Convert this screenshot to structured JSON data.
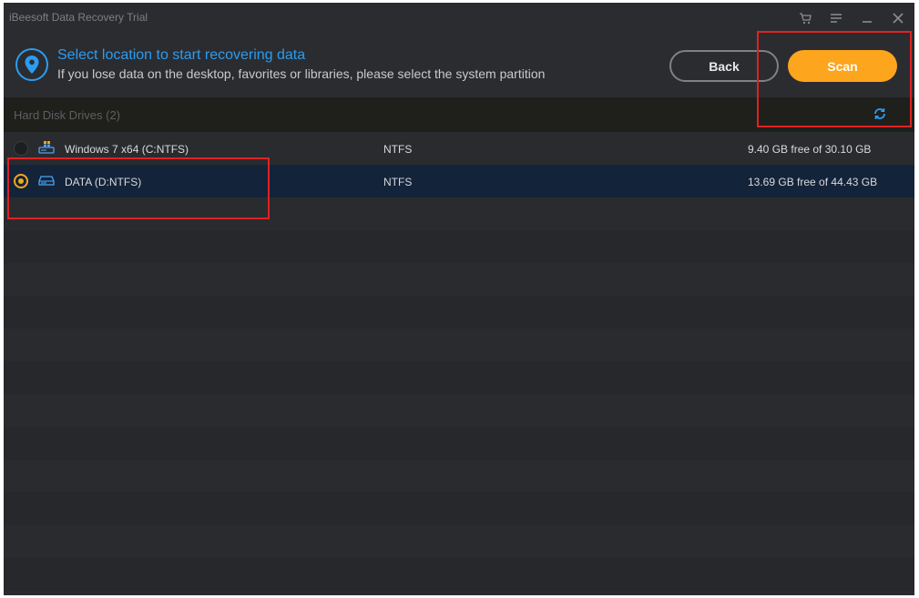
{
  "window": {
    "title": "iBeesoft Data Recovery Trial",
    "controls": [
      "cart-icon",
      "menu-icon",
      "minimize-icon",
      "close-icon"
    ]
  },
  "header": {
    "icon": "location-pin-icon",
    "title": "Select location to start recovering data",
    "subtitle": "If you lose data on the desktop, favorites or libraries, please select the system partition",
    "back_label": "Back",
    "scan_label": "Scan"
  },
  "section": {
    "label": "Hard Disk Drives (2)",
    "refresh_icon": "refresh-icon"
  },
  "drives": [
    {
      "name": "Windows 7 x64 (C:NTFS)",
      "fs": "NTFS",
      "space": "9.40 GB free of 30.10 GB",
      "selected": false,
      "icon": "windows-drive-icon"
    },
    {
      "name": "DATA (D:NTFS)",
      "fs": "NTFS",
      "space": "13.69 GB free of 44.43 GB",
      "selected": true,
      "icon": "hard-drive-icon"
    }
  ],
  "colors": {
    "accent_blue": "#2b9cf2",
    "accent_orange": "#fca51d",
    "selected_row": "#13233a",
    "highlight_red": "#e02222"
  }
}
